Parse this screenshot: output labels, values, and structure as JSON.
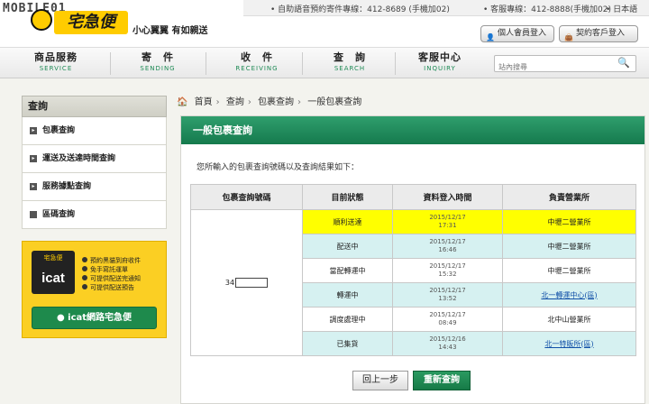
{
  "watermark": "MOBILE01",
  "brand": {
    "logo_text": "宅急便",
    "slogan": "小心翼翼 有如親送"
  },
  "util": {
    "phone_auto": "自助語音預約寄件專線：412-8689 (手機加02)",
    "phone_service": "客服專線：412-8888(手機加02)",
    "lang": "日本語"
  },
  "login": {
    "member": "個人會員登入",
    "contract": "契約客戶登入"
  },
  "nav": [
    {
      "zh": "商品服務",
      "en": "SERVICE"
    },
    {
      "zh": "寄　件",
      "en": "SENDING"
    },
    {
      "zh": "收　件",
      "en": "RECEIVING"
    },
    {
      "zh": "查　詢",
      "en": "SEARCH"
    },
    {
      "zh": "客服中心",
      "en": "INQUIRY"
    }
  ],
  "search": {
    "placeholder": "站內搜尋"
  },
  "sidebar": {
    "title": "查詢",
    "items": [
      "包裹查詢",
      "運送及送達時間查詢",
      "服務據點查詢",
      "區碼查詢"
    ]
  },
  "icat": {
    "logo_small": "宅急便",
    "logo_big": "icat",
    "features": [
      "預約黑貓到府收件",
      "免手寫託運單",
      "可提供配送完通知",
      "可提供配送預告"
    ],
    "button": "icat網路宅急便"
  },
  "breadcrumb": [
    "首頁",
    "查詢",
    "包裹查詢",
    "一般包裹查詢"
  ],
  "panel": {
    "title": "一般包裹查詢",
    "intro": "您所輸入的包裹查詢號碼以及查詢結果如下："
  },
  "table": {
    "headers": [
      "包裹查詢號碼",
      "目前狀態",
      "資料登入時間",
      "負責營業所"
    ],
    "number_prefix": "34",
    "rows": [
      {
        "status": "順利送達",
        "date": "2015/12/17",
        "time": "17:31",
        "office": "中壢二營業所",
        "link": false
      },
      {
        "status": "配送中",
        "date": "2015/12/17",
        "time": "16:46",
        "office": "中壢二營業所",
        "link": false
      },
      {
        "status": "當配轉運中",
        "date": "2015/12/17",
        "time": "15:32",
        "office": "中壢二營業所",
        "link": false
      },
      {
        "status": "轉運中",
        "date": "2015/12/17",
        "time": "13:52",
        "office": "北一轉運中心(區)",
        "link": true
      },
      {
        "status": "調度處理中",
        "date": "2015/12/17",
        "time": "08:49",
        "office": "北中山營業所",
        "link": false
      },
      {
        "status": "已集貨",
        "date": "2015/12/16",
        "time": "14:43",
        "office": "北一特販所(區)",
        "link": true
      }
    ]
  },
  "buttons": {
    "prev": "回上一步",
    "requery": "重新查詢"
  }
}
